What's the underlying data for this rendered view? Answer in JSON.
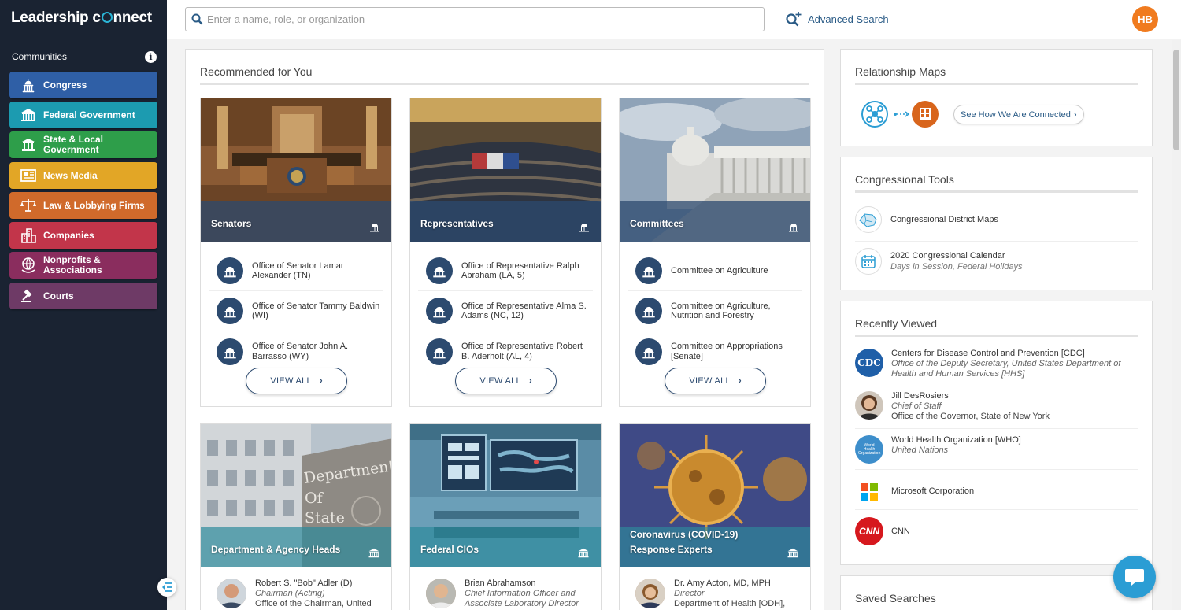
{
  "brand": {
    "logo_text_1": "Leadership c",
    "logo_text_2": "nnect"
  },
  "search": {
    "placeholder": "Enter a name, role, or organization",
    "advanced_label": "Advanced Search"
  },
  "user": {
    "initials": "HB"
  },
  "sidebar": {
    "heading": "Communities",
    "items": [
      {
        "label": "Congress",
        "color": "#2f5fa6",
        "icon": "capitol-icon"
      },
      {
        "label": "Federal Government",
        "color": "#1c9bb0",
        "icon": "federal-building-icon"
      },
      {
        "label": "State & Local Government",
        "color": "#2e9e4a",
        "icon": "state-building-icon"
      },
      {
        "label": "News Media",
        "color": "#e2a626",
        "icon": "newspaper-icon"
      },
      {
        "label": "Law & Lobbying Firms",
        "color": "#d06a2b",
        "icon": "scales-icon"
      },
      {
        "label": "Companies",
        "color": "#c2354a",
        "icon": "skyscrapers-icon"
      },
      {
        "label": "Nonprofits & Associations",
        "color": "#8a2d5e",
        "icon": "globe-hand-icon"
      },
      {
        "label": "Courts",
        "color": "#6e3a66",
        "icon": "gavel-icon"
      }
    ]
  },
  "recommended": {
    "title": "Recommended for You",
    "view_all": "VIEW ALL",
    "cards": [
      {
        "title": "Senators",
        "items": [
          "Office of Senator Lamar Alexander (TN)",
          "Office of Senator Tammy Baldwin (WI)",
          "Office of Senator John A. Barrasso (WY)"
        ]
      },
      {
        "title": "Representatives",
        "items": [
          "Office of Representative Ralph Abraham (LA, 5)",
          "Office of Representative Alma S. Adams (NC, 12)",
          "Office of Representative Robert B. Aderholt (AL, 4)"
        ]
      },
      {
        "title": "Committees",
        "items": [
          "Committee on Agriculture",
          "Committee on Agriculture, Nutrition and Forestry",
          "Committee on Appropriations [Senate]"
        ]
      },
      {
        "title": "Department & Agency Heads",
        "image_text": "Department Of State",
        "person": {
          "name": "Robert S. \"Bob\" Adler (D)",
          "title": "Chairman (Acting)",
          "org": "Office of the Chairman, United"
        }
      },
      {
        "title": "Federal CIOs",
        "person": {
          "name": "Brian Abrahamson",
          "title": "Chief Information Officer and",
          "org": "Associate Laboratory Director"
        }
      },
      {
        "title": "Coronavirus (COVID-19) Response Experts",
        "person": {
          "name": "Dr. Amy Acton, MD, MPH",
          "title": "Director",
          "org": "Department of Health [ODH],"
        }
      }
    ]
  },
  "relationship_maps": {
    "title": "Relationship Maps",
    "button": "See How We Are Connected"
  },
  "congressional_tools": {
    "title": "Congressional Tools",
    "items": [
      {
        "label": "Congressional District Maps",
        "sub": ""
      },
      {
        "label": "2020 Congressional Calendar",
        "sub": "Days in Session, Federal Holidays"
      }
    ]
  },
  "recently_viewed": {
    "title": "Recently Viewed",
    "items": [
      {
        "name": "Centers for Disease Control and Prevention [CDC]",
        "sub_italic": "Office of the Deputy Secretary, United States Department of Health and Human Services [HHS]",
        "sub": "",
        "icon_text": "CDC"
      },
      {
        "name": "Jill DesRosiers",
        "sub_italic": "Chief of Staff",
        "sub": "Office of the Governor, State of New York",
        "icon_text": ""
      },
      {
        "name": "World Health Organization [WHO]",
        "sub_italic": "United Nations",
        "sub": "",
        "icon_text": "World Health Organization"
      },
      {
        "name": "Microsoft Corporation",
        "sub_italic": "",
        "sub": "",
        "icon_text": ""
      },
      {
        "name": "CNN",
        "sub_italic": "",
        "sub": "",
        "icon_text": "CNN"
      }
    ]
  },
  "saved_searches": {
    "title": "Saved Searches"
  }
}
